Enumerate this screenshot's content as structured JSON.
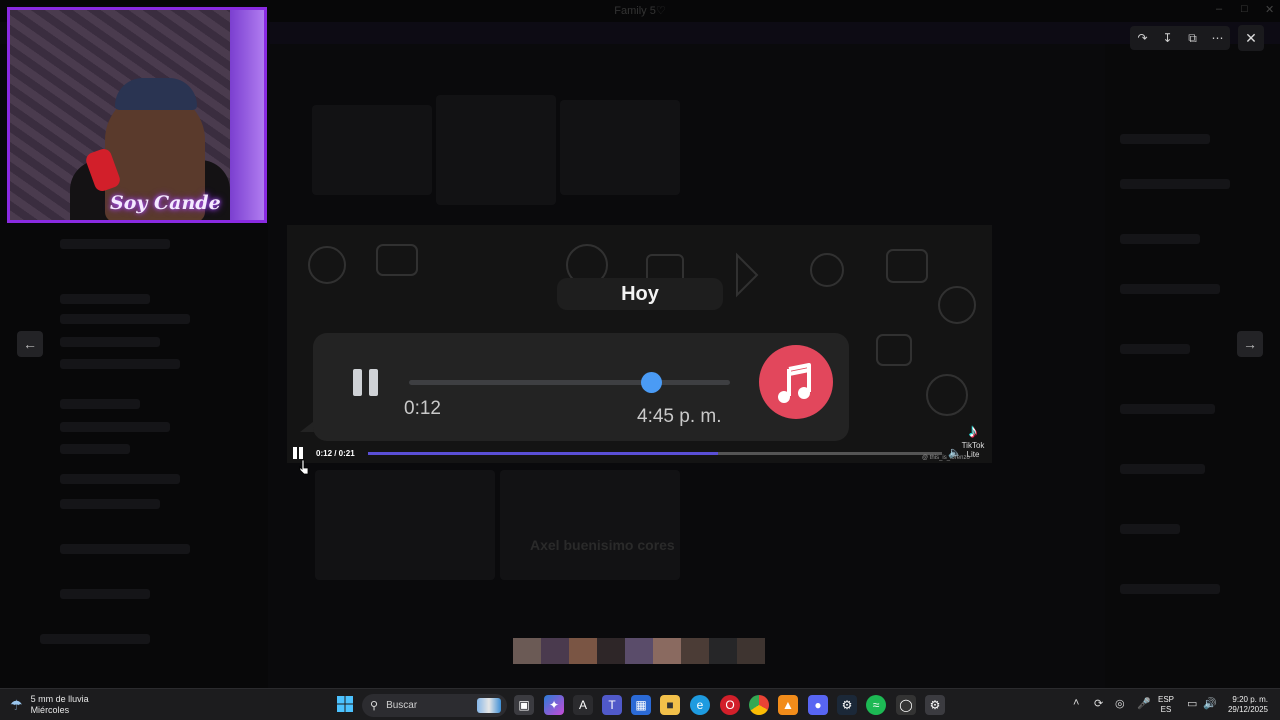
{
  "background_app": {
    "window_title": "Family 5♡"
  },
  "viewer": {
    "controls": [
      "forward-icon",
      "download-icon",
      "open-external-icon",
      "more-icon"
    ],
    "close": "✕",
    "prev": "←",
    "next": "→"
  },
  "webcam": {
    "logo_text": "Soy Cande"
  },
  "video": {
    "date_chip": "Hoy",
    "audio_elapsed": "0:12",
    "audio_timestamp": "4:45 p. m.",
    "audio_progress": 0.75,
    "player_time": "0:12 / 0:21",
    "player_progress": 0.61,
    "watermark": "TikTok",
    "watermark_sub": "Lite",
    "handle": "@ this_is_lorenzo",
    "accent_colors": {
      "knob": "#4a9bf5",
      "music_button": "#e2475c",
      "player_fill": "#5a4fd6"
    }
  },
  "background_caption": "Axel buenisimo cores",
  "taskbar": {
    "weather_line1": "5 mm de lluvia",
    "weather_line2": "Miércoles",
    "search_label": "Buscar",
    "lang_line1": "ESP",
    "lang_line2": "ES",
    "time": "9:20 p. m.",
    "date": "29/12/2025"
  }
}
